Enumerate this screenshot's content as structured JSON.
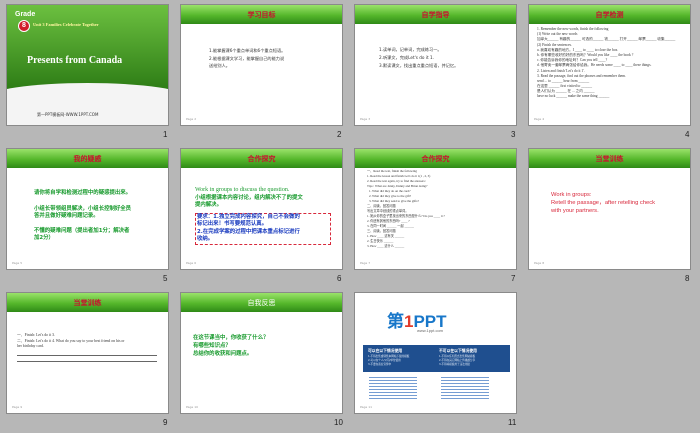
{
  "slides": [
    {
      "number": "1",
      "grade_word": "Grade",
      "grade_num": "8",
      "unit": "Unit 3 Families Celebrate Together",
      "title": "Presents from Canada",
      "site": "第一PPT模板网-WWW.1PPT.COM"
    },
    {
      "number": "2",
      "banner": "学习目标",
      "lines": [
        "1.能掌握课6个重点单词和6个重点短语。",
        "2.能根据课文学习，能掌握自己的能力说",
        "送给别人。"
      ],
      "page": "Page 2"
    },
    {
      "number": "3",
      "banner": "自学指导",
      "lines": [
        "1.读单词，记单词，完成练习一。",
        "2.听课文，完成Let's do it 1.",
        "3.默读课文，找出重点重点短语，并记忆。"
      ],
      "page": "Page 3"
    },
    {
      "number": "4",
      "banner": "自学检测",
      "lines": [
        "1. Remember the new words, finish the following",
        "(1) Write out the new words",
        "加拿大______ 有趣的______ 可选的______ 钱______ 打开______ 邮票______ 收集______",
        "(2) Finish the sentences.",
        "a. 我喜欢有趣的地方。I ____ to ____ to close the box.",
        "b. 你有哪些收好的好的东西吗？Would you like ____ the book ?",
        "c. 你能告诉我你的地址吗？Can you tell ____?",
        "d. 他寄卖一套邮票两张给你给我。He needs some ____ to ____ these things.",
        "2. Listen and finish 'Let's do it 1'.",
        "3. Read the passage, find out the phrases and remember them.",
        "send ... to ______ hear from ______",
        "在这里 ______ first visited to ______",
        "是人们认为 ______ 在 ... 之内 ______",
        "have no luck ______ make the same thing ______"
      ],
      "page": "Page 4"
    },
    {
      "number": "5",
      "banner": "我的疑惑",
      "lines": [
        "请你将自学和检测过程中的疑惑提出来。",
        "小组长带领组员解决，小组长控制好全员",
        "答并且做好疑难问题记录。",
        "不懂的疑难问题（提出者加1分；解决者",
        "加2分）"
      ],
      "page": "Page 5"
    },
    {
      "number": "6",
      "banner": "合作探究",
      "lines_green": [
        "Work in groups to discuss the question.",
        "小组根据课本内容讨论，组内解决不了的提文",
        "提内解决。"
      ],
      "lines_blue": [
        "要求：1.独立完成内容探究，自己不会做的",
        "标记出来！书写要规范认真。",
        "2.在完成学案的过程中把课本重点标记进行",
        "收纳。"
      ],
      "page": "Page 6"
    },
    {
      "number": "7",
      "banner": "合作探究",
      "lines": [
        "一、Read the text, finish the following",
        "1. Read the lesson and finish Let's do it 1(1 , 2, 3)",
        "2. Read the text again, try to find the answers:",
        "Tips : What are Jenny, Danny and Brian doing?",
        "1. What did they do on the card?",
        "2. What did they give to the gift?",
        "3. What did they send to give the gifts?",
        "二、阅读，回答问题",
        "写出文章中划线的重点单词。",
        "1. 她从你的盒子里找出来的东西是什么? Do you ____ it ?",
        "2. 你还有其他的东西吗? ____ ?",
        "3. 在同一时间 ______ 一起 ______",
        "三、阅读，回答问题",
        "1. How ____ 这有关 ______",
        "2. 生日快乐 ______",
        "3. How ____ 这什么 ______"
      ],
      "page": "Page 7"
    },
    {
      "number": "8",
      "banner": "当堂训练",
      "lines": [
        "Work in groups:",
        "Retell the passage，after retelling check",
        "with your partners."
      ],
      "page": "Page 8"
    },
    {
      "number": "9",
      "banner": "当堂训练",
      "lines": [
        "一、Finish: Let's do it 3.",
        "二、Finish: Let's do it 4.  What do you say to your best friend on his or",
        "her birthday card."
      ],
      "page": "Page 9"
    },
    {
      "number": "10",
      "banner": "自我反思",
      "lines": [
        "在这节课当中，你收获了什么？",
        "有哪些知识点？",
        "总结你的收获和问题点。"
      ],
      "page": "Page 10"
    },
    {
      "number": "11",
      "logo_prefix": "第",
      "logo_one": "1",
      "logo_suffix": "PPT",
      "site": "www.1ppt.com",
      "col1_title": "可以在以下情况使用",
      "col2_title": "不可以在以下情况使用",
      "col1_lines": [
        "1.不得出售或转售本网站下载的模板",
        "2.可以在个人/公司/单位使用",
        "3.不要在商业宣传中"
      ],
      "col2_lines": [
        "1.不得以任何形式出售网站模板",
        "2.不得在其它网站上传播或分享",
        "3.不得将模板用于违法用途"
      ],
      "page": "Page 11"
    }
  ],
  "colors": {
    "banner_green": "#55b72b",
    "title_red": "#c8102e",
    "text_green": "#1a9b2f",
    "text_blue": "#1a3bbf",
    "background": "#b7b7b7"
  }
}
